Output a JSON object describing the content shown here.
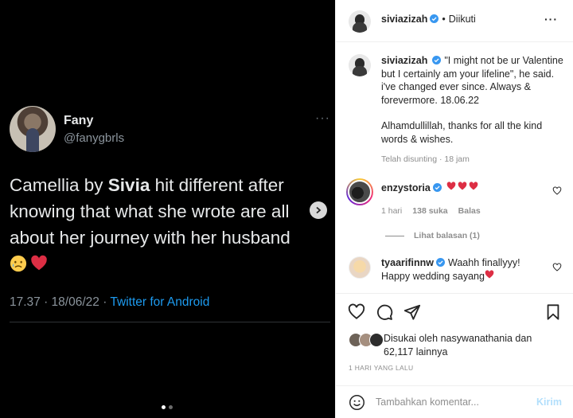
{
  "tweet": {
    "name": "Fany",
    "handle": "@fanygbrls",
    "text_before": "Camellia by ",
    "text_bold": "Sivia",
    "text_after": " hit different after knowing that what she wrote are all about her journey with her husband",
    "emojis": [
      "crying-face",
      "red-heart"
    ],
    "time_date": "17.37 · 18/06/22 · ",
    "source": "Twitter for Android",
    "more": "···"
  },
  "carousel": {
    "slide_count": 2,
    "active_index": 0
  },
  "header": {
    "username": "siviazizah",
    "separator": "•",
    "follow_status": "Diikuti",
    "more": "···"
  },
  "caption": {
    "username": "siviazizah",
    "paragraph1": "\"I might not be ur Valentine but I certainly am your lifeline\", he said. i've changed ever since. Always & forevermore. 18.06.22",
    "paragraph2": "Alhamdullillah, thanks for all the kind words & wishes.",
    "edited": "Telah disunting · 18 jam"
  },
  "comments": [
    {
      "username": "enzystoria",
      "text": "",
      "hearts": 3,
      "age": "1 hari",
      "likes": "138 suka",
      "reply": "Balas",
      "view_replies": "Lihat balasan (1)"
    },
    {
      "username": "tyaarifinnw",
      "text": "Waahh finallyyy! Happy wedding sayang"
    }
  ],
  "likes": {
    "prefix": "Disukai oleh ",
    "user": "nasywanathania",
    "middle": " dan ",
    "count": "62,117 lainnya"
  },
  "posted": "1 HARI YANG LALU",
  "composer": {
    "placeholder": "Tambahkan komentar...",
    "post_label": "Kirim"
  },
  "colors": {
    "twitter_blue": "#1d9bf0",
    "verified_blue": "#3897f0",
    "heart_red": "#ed4956",
    "post_disabled": "#b2dffc"
  }
}
